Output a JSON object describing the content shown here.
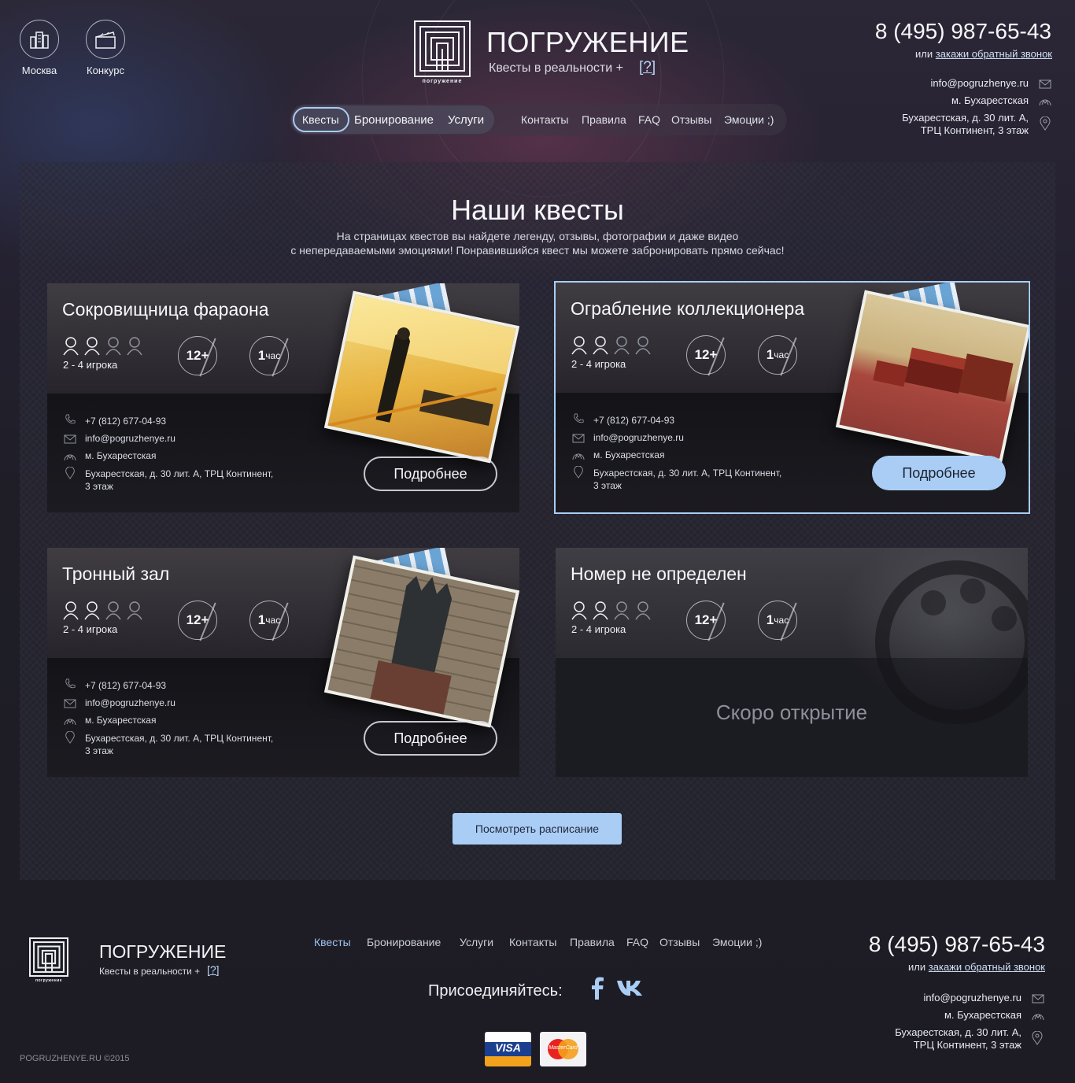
{
  "header": {
    "city_label": "Москва",
    "contest_label": "Конкурс",
    "brand": "ПОГРУЖЕНИЕ",
    "logo_caption": "погружение",
    "slogan": "Квесты в реальности +",
    "help": "[?]",
    "phone": "8 (495) 987-65-43",
    "callback_prefix": "или",
    "callback_link": "закажи обратный звонок",
    "email": "info@pogruzhenye.ru",
    "metro": "м. Бухарестская",
    "address_line1": "Бухарестская, д. 30 лит. А,",
    "address_line2": "ТРЦ Континент, 3 этаж"
  },
  "nav": {
    "main": [
      "Квесты",
      "Бронирование",
      "Услуги"
    ],
    "secondary": [
      "Контакты",
      "Правила",
      "FAQ",
      "Отзывы",
      "Эмоции ;)"
    ]
  },
  "main": {
    "title": "Наши квесты",
    "subtitle_line1": "На страницах квестов вы найдете легенду, отзывы, фотографии и даже видео",
    "subtitle_line2": "с непередаваемыми эмоциями! Понравившийся квест мы можете забронировать прямо сейчас!"
  },
  "quests": [
    {
      "title": "Сокровищница фараона",
      "players": "2 - 4 игрока",
      "age": "12+",
      "duration_num": "1",
      "duration_unit": "час",
      "phone": "+7 (812) 677-04-93",
      "email": "info@pogruzhenye.ru",
      "metro": "м. Бухарестская",
      "address_line1": "Бухарестская, д. 30 лит. А, ТРЦ Континент,",
      "address_line2": "3 этаж",
      "button": "Подробнее"
    },
    {
      "title": "Ограбление коллекционера",
      "players": "2 - 4 игрока",
      "age": "12+",
      "duration_num": "1",
      "duration_unit": "час",
      "phone": "+7 (812) 677-04-93",
      "email": "info@pogruzhenye.ru",
      "metro": "м. Бухарестская",
      "address_line1": "Бухарестская, д. 30 лит. А, ТРЦ Континент,",
      "address_line2": "3 этаж",
      "button": "Подробнее"
    },
    {
      "title": "Тронный зал",
      "players": "2 - 4 игрока",
      "age": "12+",
      "duration_num": "1",
      "duration_unit": "час",
      "phone": "+7 (812) 677-04-93",
      "email": "info@pogruzhenye.ru",
      "metro": "м. Бухарестская",
      "address_line1": "Бухарестская, д. 30 лит. А, ТРЦ Континент,",
      "address_line2": "3 этаж",
      "button": "Подробнее"
    },
    {
      "title": "Номер не определен",
      "players": "2 - 4 игрока",
      "age": "12+",
      "duration_num": "1",
      "duration_unit": "час",
      "soon": "Скоро открытие"
    }
  ],
  "schedule_button": "Посмотреть расписание",
  "footer": {
    "brand": "ПОГРУЖЕНИЕ",
    "logo_caption": "погружение",
    "slogan": "Квесты в реальности +",
    "help": "[?]",
    "nav": [
      "Квесты",
      "Бронирование",
      "Услуги",
      "Контакты",
      "Правила",
      "FAQ",
      "Отзывы",
      "Эмоции ;)"
    ],
    "join": "Присоединяйтесь:",
    "phone": "8 (495) 987-65-43",
    "callback_prefix": "или",
    "callback_link": "закажи обратный звонок",
    "email": "info@pogruzhenye.ru",
    "metro": "м. Бухарестская",
    "address_line1": "Бухарестская, д. 30 лит. А,",
    "address_line2": "ТРЦ Континент, 3 этаж",
    "copyright": "POGRUZHENYE.RU ©2015",
    "visa": "VISA",
    "mastercard": "MasterCard"
  },
  "colors": {
    "accent": "#a9cdf5",
    "background": "#1f1e27"
  }
}
